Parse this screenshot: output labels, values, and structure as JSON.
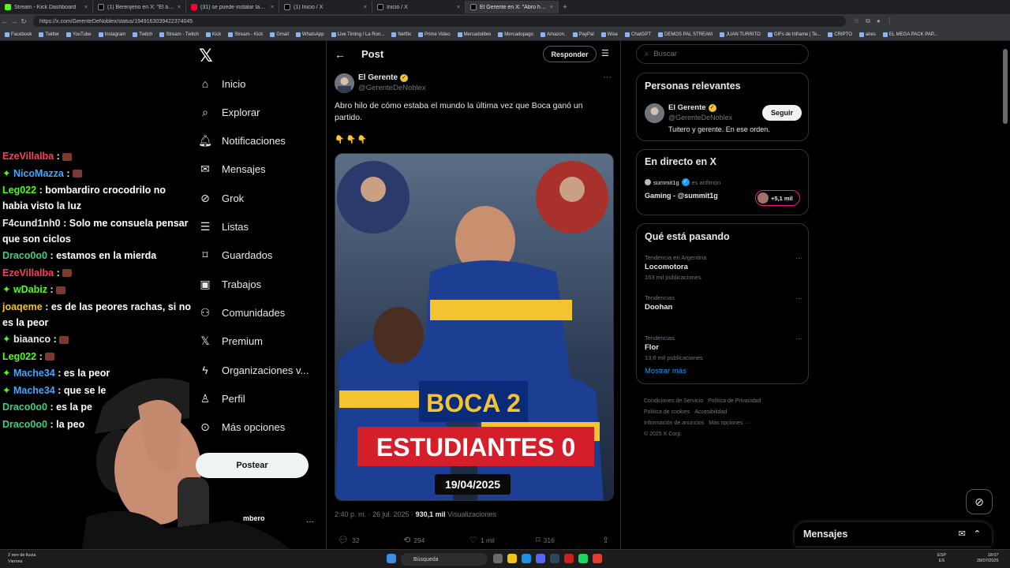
{
  "browser": {
    "tabs": [
      {
        "title": "Stream - Kick Dashboard",
        "icon": "kick-icon"
      },
      {
        "title": "(1) Berenjeno en X: \"El árbitro en",
        "icon": "x-icon"
      },
      {
        "title": "(31) se puede instalar lamparas",
        "icon": "youtube-icon"
      },
      {
        "title": "(1) Inicio / X",
        "icon": "x-icon"
      },
      {
        "title": "Inicio / X",
        "icon": "x-icon"
      },
      {
        "title": "El Gerente en X: \"Abro hilo de có",
        "icon": "x-icon",
        "active": true
      }
    ],
    "url": "https://x.com/GerenteDeNoblex/status/1949163039422374045",
    "bookmarks": [
      "Facebook",
      "Twitter",
      "YouTube",
      "Instagram",
      "Twitch",
      "Stream - Twitch",
      "Kick",
      "Stream - Kick",
      "Gmail",
      "WhatsApp",
      "Live Timing / La Ron...",
      "Netflix",
      "Prime Video",
      "Mercadolibre",
      "Mercadopago",
      "Amazon.",
      "PayPal",
      "Wise",
      "ChatGPT",
      "DEMOS PAL STREAM",
      "JUAN TURRITO",
      "GIFs de Inframe | Te...",
      "CRIPTO",
      "aires",
      "EL MEGA PACK PAP..."
    ]
  },
  "chat": [
    {
      "user": "EzeVillalba",
      "color": "#ff3f5a",
      "text": "",
      "emote": true
    },
    {
      "user": "NicoMazza",
      "color": "#3fa8ff",
      "text": "",
      "badge": "✦",
      "emote": true
    },
    {
      "user": "Leg022",
      "color": "#53fc18",
      "text": "bombardiro crocodrilo no habia visto la luz"
    },
    {
      "user": "F4cund1nh0",
      "color": "#e7e9ea",
      "text": "Solo me consuela pensar que son ciclos"
    },
    {
      "user": "Draco0o0",
      "color": "#3fd17a",
      "text": "estamos en la mierda"
    },
    {
      "user": "EzeVillalba",
      "color": "#ff3f5a",
      "text": "",
      "emote": true
    },
    {
      "user": "wDabiz",
      "color": "#53fc18",
      "text": "",
      "badge": "✦",
      "emote": true
    },
    {
      "user": "joaqeme",
      "color": "#f4c430",
      "text": "es de las peores rachas, si no es la peor"
    },
    {
      "user": "biaanco",
      "color": "#e7e9ea",
      "text": "",
      "badge": "✦",
      "emote": true
    },
    {
      "user": "Leg022",
      "color": "#53fc18",
      "text": "",
      "emote": true
    },
    {
      "user": "Mache34",
      "color": "#3fa8ff",
      "text": "es la peor",
      "badge": "✦"
    },
    {
      "user": "Mache34",
      "color": "#3fa8ff",
      "text": "que se le",
      "badge": "✦"
    },
    {
      "user": "Draco0o0",
      "color": "#3fd17a",
      "text": "es la pe"
    },
    {
      "user": "Draco0o0",
      "color": "#3fd17a",
      "text": "la peo"
    }
  ],
  "nav": {
    "items": [
      {
        "label": "Inicio",
        "icon": "home-icon"
      },
      {
        "label": "Explorar",
        "icon": "search-icon"
      },
      {
        "label": "Notificaciones",
        "icon": "bell-icon"
      },
      {
        "label": "Mensajes",
        "icon": "mail-icon"
      },
      {
        "label": "Grok",
        "icon": "grok-icon"
      },
      {
        "label": "Listas",
        "icon": "list-icon"
      },
      {
        "label": "Guardados",
        "icon": "bookmark-icon"
      },
      {
        "label": "Trabajos",
        "icon": "briefcase-icon"
      },
      {
        "label": "Comunidades",
        "icon": "communities-icon"
      },
      {
        "label": "Premium",
        "icon": "x-premium-icon"
      },
      {
        "label": "Organizaciones v...",
        "icon": "lightning-icon"
      },
      {
        "label": "Perfil",
        "icon": "person-icon"
      },
      {
        "label": "Más opciones",
        "icon": "more-circle-icon"
      }
    ],
    "post_button": "Postear",
    "account_name": "mbero"
  },
  "post": {
    "header_title": "Post",
    "reply_button": "Responder",
    "author": "El Gerente",
    "handle": "@GerenteDeNoblex",
    "text": "Abro hilo de cómo estaba el mundo la última vez que Boca ganó un partido.",
    "emoji": "👇👇👇",
    "image": {
      "line1": "BOCA 2",
      "line2": "ESTUDIANTES 0",
      "date": "19/04/2025"
    },
    "timestamp": "2:40 p. m. · 26 jul. 2025 ·",
    "views": "930,1 mil",
    "views_label": "Visualizaciones",
    "stats": {
      "replies": "32",
      "reposts": "294",
      "likes": "1 mil",
      "bookmarks": "316"
    }
  },
  "sidebar": {
    "search_placeholder": "Buscar",
    "relevant": {
      "title": "Personas relevantes",
      "name": "El Gerente",
      "handle": "@GerenteDeNoblex",
      "bio": "Tuitero y gerente. En ese orden.",
      "follow_button": "Seguir"
    },
    "live": {
      "title": "En directo en X",
      "host": "summit1g",
      "host_role": "es anfitrión",
      "stream_title": "Gaming - @summit1g",
      "listeners": "+5,1 mil"
    },
    "trends": {
      "title": "Qué está pasando",
      "items": [
        {
          "context": "Tendencia en Argentina",
          "name": "Locomotora",
          "count": "163 mil publicaciones"
        },
        {
          "context": "Tendencias",
          "name": "Doohan",
          "count": ""
        },
        {
          "context": "Tendencias",
          "name": "Flor",
          "count": "13,6 mil publicaciones"
        }
      ],
      "show_more": "Mostrar más"
    },
    "footer": [
      "Condiciones de Servicio",
      "Política de Privacidad",
      "Política de cookies",
      "Accesibilidad",
      "Información de anuncios",
      "Más opciones ···",
      "© 2025 X Corp."
    ]
  },
  "messages_dock": {
    "title": "Mensajes"
  },
  "taskbar": {
    "weather_line1": "2 mm de lluvia",
    "weather_line2": "Viernes",
    "search_placeholder": "Búsqueda",
    "lang_line1": "ESP",
    "lang_line2": "ES",
    "time": "18:07",
    "date": "28/07/2025"
  },
  "colors": {
    "x_blue": "#1d9bf0",
    "kick_green": "#53fc18",
    "boca_blue": "#1c3f94",
    "boca_yellow": "#f4c430",
    "live_pink": "#f91880"
  }
}
